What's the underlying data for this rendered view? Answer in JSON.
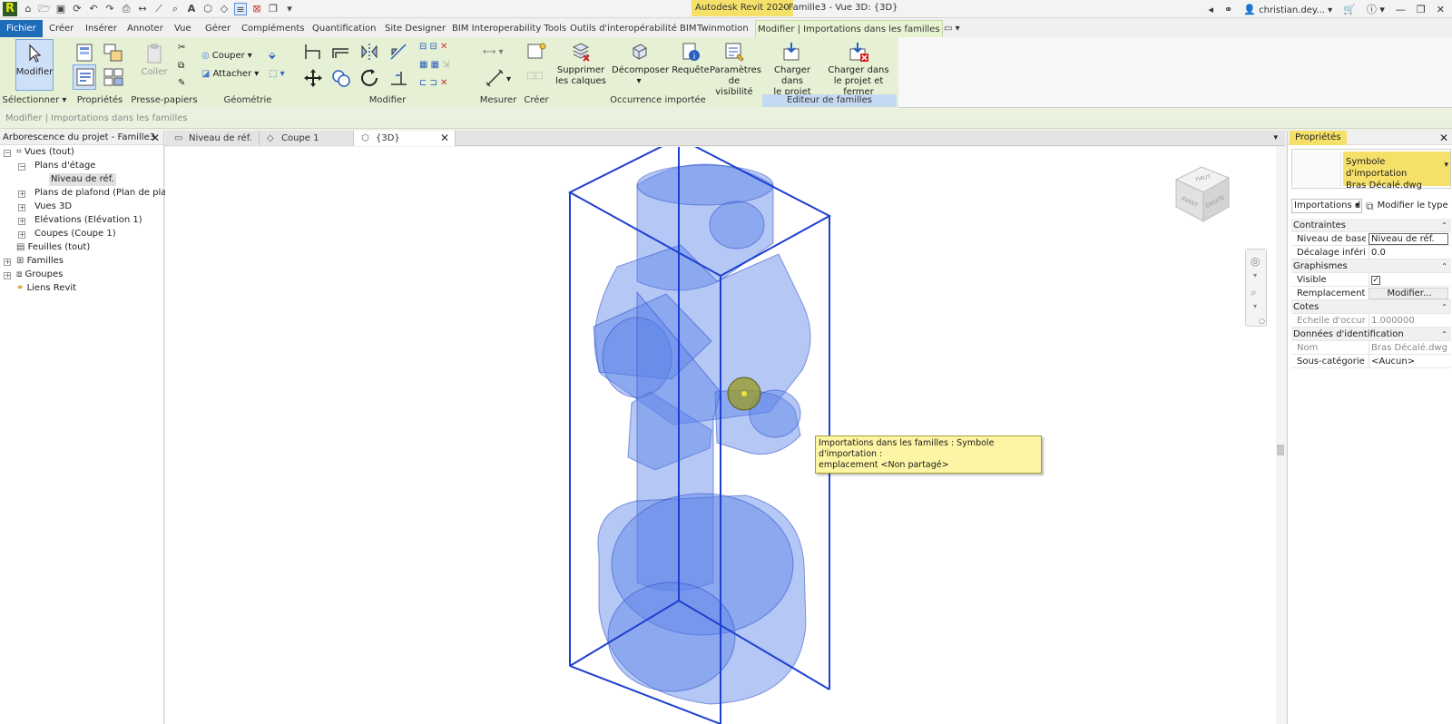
{
  "app": {
    "logo": "R",
    "title_app": "Autodesk Revit 2020",
    "title_doc": "- Famille3 - Vue 3D: {3D}",
    "user": "christian.dey...",
    "qat_icons": [
      "open-icon",
      "save-icon",
      "sync-icon",
      "undo-icon",
      "redo-icon",
      "print-icon",
      "measure-icon",
      "dimension-icon",
      "tag-icon",
      "text-icon",
      "3d-view-icon",
      "section-icon",
      "thin-lines-icon",
      "close-hidden-icon",
      "switch-windows-icon",
      "customize-icon"
    ]
  },
  "menu": {
    "tabs": [
      {
        "label": "Fichier"
      },
      {
        "label": "Créer"
      },
      {
        "label": "Insérer"
      },
      {
        "label": "Annoter"
      },
      {
        "label": "Vue"
      },
      {
        "label": "Gérer"
      },
      {
        "label": "Compléments"
      },
      {
        "label": "Quantification"
      },
      {
        "label": "Site Designer"
      },
      {
        "label": "BIM Interoperability Tools"
      },
      {
        "label": "Outils d'interopérabilité BIM"
      },
      {
        "label": "Twinmotion"
      },
      {
        "label": "Modifier | Importations dans les familles"
      }
    ]
  },
  "ribbon": {
    "modify_label": "Modifier",
    "coller_label": "Coller",
    "couper_label": "Couper",
    "attacher_label": "Attacher",
    "supprimer_label1": "Supprimer",
    "supprimer_label2": "les calques",
    "decomposer_label": "Décomposer",
    "requete_label": "Requête",
    "params_label1": "Paramètres",
    "params_label2": "de visibilité",
    "charger_label1": "Charger dans",
    "charger_label2": "le projet",
    "charger_fermer_label1": "Charger dans",
    "charger_fermer_label2": "le projet et fermer",
    "panels": [
      {
        "label": "Sélectionner ▾"
      },
      {
        "label": "Propriétés"
      },
      {
        "label": "Presse-papiers"
      },
      {
        "label": "Géométrie"
      },
      {
        "label": "Modifier"
      },
      {
        "label": "Mesurer"
      },
      {
        "label": "Créer"
      },
      {
        "label": "Occurrence importée"
      },
      {
        "label": "Editeur de familles"
      }
    ]
  },
  "optionsbar": {
    "text": "Modifier | Importations dans les familles"
  },
  "browser": {
    "title": "Arborescence du projet - Famille3",
    "nodes": [
      {
        "label": "Vues (tout)"
      },
      {
        "label": "Plans d'étage"
      },
      {
        "label": "Niveau de réf."
      },
      {
        "label": "Plans de plafond (Plan de plafon"
      },
      {
        "label": "Vues 3D"
      },
      {
        "label": "Elévations (Elévation 1)"
      },
      {
        "label": "Coupes (Coupe 1)"
      },
      {
        "label": "Feuilles (tout)"
      },
      {
        "label": "Familles"
      },
      {
        "label": "Groupes"
      },
      {
        "label": "Liens Revit"
      }
    ]
  },
  "doctabs": [
    {
      "label": "Niveau de réf."
    },
    {
      "label": "Coupe 1"
    },
    {
      "label": "{3D}"
    }
  ],
  "viewcube": {
    "top": "HAUT",
    "front": "AVANT",
    "right": "DROITE"
  },
  "canvas": {
    "tooltip_line1": "Importations dans les familles : Symbole d'importation :",
    "tooltip_line2": "emplacement <Non partagé>",
    "model_color": "#5b83e8",
    "edge_color": "#1d3fd1"
  },
  "properties": {
    "title": "Propriétés",
    "type_line1": "Symbole d'importation",
    "type_line2": "Bras Décalé.dwg",
    "instance_filter": "Importations d",
    "edit_type": "Modifier le type",
    "groups": [
      {
        "label": "Contraintes"
      },
      {
        "label": "Graphismes"
      },
      {
        "label": "Cotes"
      },
      {
        "label": "Données d'identification"
      }
    ],
    "rows": {
      "niveau": {
        "k": "Niveau de base",
        "v": "Niveau de réf."
      },
      "decalage": {
        "k": "Décalage inférie...",
        "v": "0.0"
      },
      "visible": {
        "k": "Visible",
        "v": "✓"
      },
      "remplacement": {
        "k": "Remplacement...",
        "v": "Modifier..."
      },
      "echelle": {
        "k": "Echelle d'occurr...",
        "v": "1.000000"
      },
      "nom": {
        "k": "Nom",
        "v": "Bras Décalé.dwg"
      },
      "souscat": {
        "k": "Sous-catégorie",
        "v": "<Aucun>"
      }
    }
  }
}
